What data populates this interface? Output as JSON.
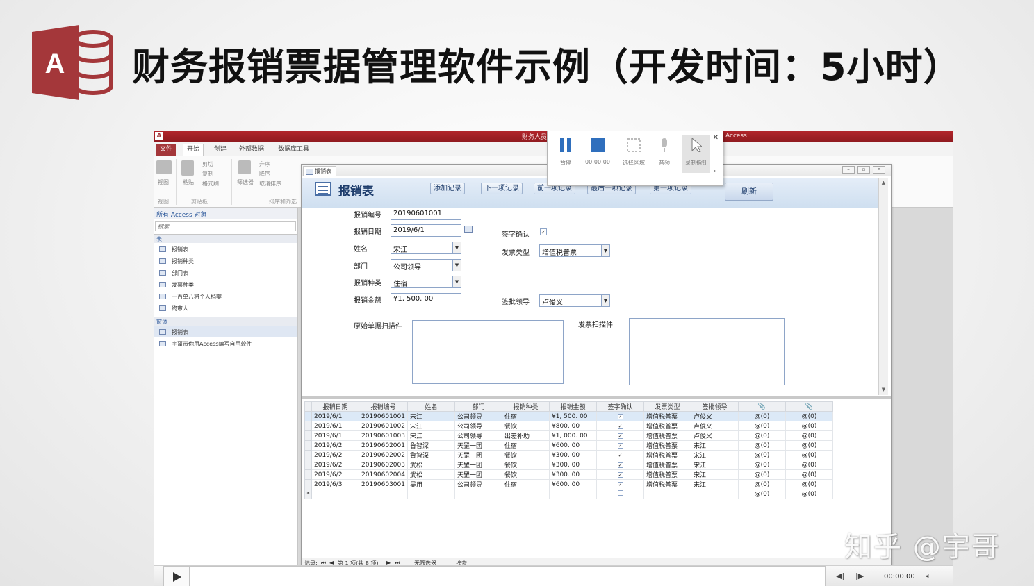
{
  "slide": {
    "title": "财务报销票据管理软件示例（开发时间：5小时）",
    "logo_letter": "A",
    "watermark": "知乎 @宇哥"
  },
  "app": {
    "window_title": "财务人员",
    "app_name": "Access",
    "ribbon_tabs": [
      "文件",
      "开始",
      "创建",
      "外部数据",
      "数据库工具"
    ],
    "ribbon": {
      "view": "视图",
      "paste": "粘贴",
      "cut": "剪切",
      "copy": "复制",
      "format_painter": "格式刷",
      "filter": "筛选器",
      "asc": "升序",
      "desc": "降序",
      "remove_sort": "取消排序",
      "group_view": "视图",
      "group_clipboard": "剪贴板",
      "group_sort": "排序和筛选"
    },
    "nav": {
      "header": "所有 Access 对象",
      "search_placeholder": "搜索...",
      "tables_group": "表",
      "tables": [
        "报销表",
        "报销种类",
        "部门表",
        "发票种类",
        "一百单八将个人档案",
        "终审人"
      ],
      "forms_group": "窗体",
      "forms": [
        "报销表",
        "宇哥带你用Access编写自用软件"
      ]
    }
  },
  "form": {
    "tab_label": "报销表",
    "title": "报销表",
    "buttons": {
      "add": "添加记录",
      "next": "下一项记录",
      "prev": "前一项记录",
      "last": "最后一项记录",
      "first": "第一项记录",
      "refresh": "刷新"
    },
    "fields": {
      "id_label": "报销编号",
      "id_value": "20190601001",
      "date_label": "报销日期",
      "date_value": "2019/6/1",
      "name_label": "姓名",
      "name_value": "宋江",
      "dept_label": "部门",
      "dept_value": "公司领导",
      "type_label": "报销种类",
      "type_value": "住宿",
      "amount_label": "报销金额",
      "amount_value": "¥1, 500. 00",
      "sign_label": "签字确认",
      "sign_checked": true,
      "invoice_label": "发票类型",
      "invoice_value": "增值税普票",
      "approver_label": "签批领导",
      "approver_value": "卢俊义",
      "scan_orig_label": "原始单据扫描件",
      "scan_invoice_label": "发票扫描件"
    }
  },
  "datasheet": {
    "columns": [
      "报销日期",
      "报销编号",
      "姓名",
      "部门",
      "报销种类",
      "报销金额",
      "签字确认",
      "发票类型",
      "签批领导",
      "📎",
      "📎"
    ],
    "rows": [
      [
        "2019/6/1",
        "20190601001",
        "宋江",
        "公司领导",
        "住宿",
        "¥1, 500. 00",
        "☑",
        "增值税普票",
        "卢俊义",
        "@(0)",
        "@(0)"
      ],
      [
        "2019/6/1",
        "20190601002",
        "宋江",
        "公司领导",
        "餐饮",
        "¥800. 00",
        "☑",
        "增值税普票",
        "卢俊义",
        "@(0)",
        "@(0)"
      ],
      [
        "2019/6/1",
        "20190601003",
        "宋江",
        "公司领导",
        "出差补助",
        "¥1, 000. 00",
        "☑",
        "增值税普票",
        "卢俊义",
        "@(0)",
        "@(0)"
      ],
      [
        "2019/6/2",
        "20190602001",
        "鲁智深",
        "天罡一团",
        "住宿",
        "¥600. 00",
        "☑",
        "增值税普票",
        "宋江",
        "@(0)",
        "@(0)"
      ],
      [
        "2019/6/2",
        "20190602002",
        "鲁智深",
        "天罡一团",
        "餐饮",
        "¥300. 00",
        "☑",
        "增值税普票",
        "宋江",
        "@(0)",
        "@(0)"
      ],
      [
        "2019/6/2",
        "20190602003",
        "武松",
        "天罡一团",
        "餐饮",
        "¥300. 00",
        "☑",
        "增值税普票",
        "宋江",
        "@(0)",
        "@(0)"
      ],
      [
        "2019/6/2",
        "20190602004",
        "武松",
        "天罡一团",
        "餐饮",
        "¥300. 00",
        "☑",
        "增值税普票",
        "宋江",
        "@(0)",
        "@(0)"
      ],
      [
        "2019/6/3",
        "20190603001",
        "吴用",
        "公司领导",
        "住宿",
        "¥600. 00",
        "☑",
        "增值税普票",
        "宋江",
        "@(0)",
        "@(0)"
      ]
    ],
    "new_row_marker": "*",
    "record_nav": {
      "label": "记录:",
      "position": "第 1 项(共 8 项)",
      "filter": "无筛选器",
      "search": "搜索"
    }
  },
  "recorder": {
    "pause": "暂停",
    "time": "00:00:00",
    "select_area": "选择区域",
    "audio": "音频",
    "record_pointer": "录制指针"
  },
  "player": {
    "time": "00:00.00"
  }
}
